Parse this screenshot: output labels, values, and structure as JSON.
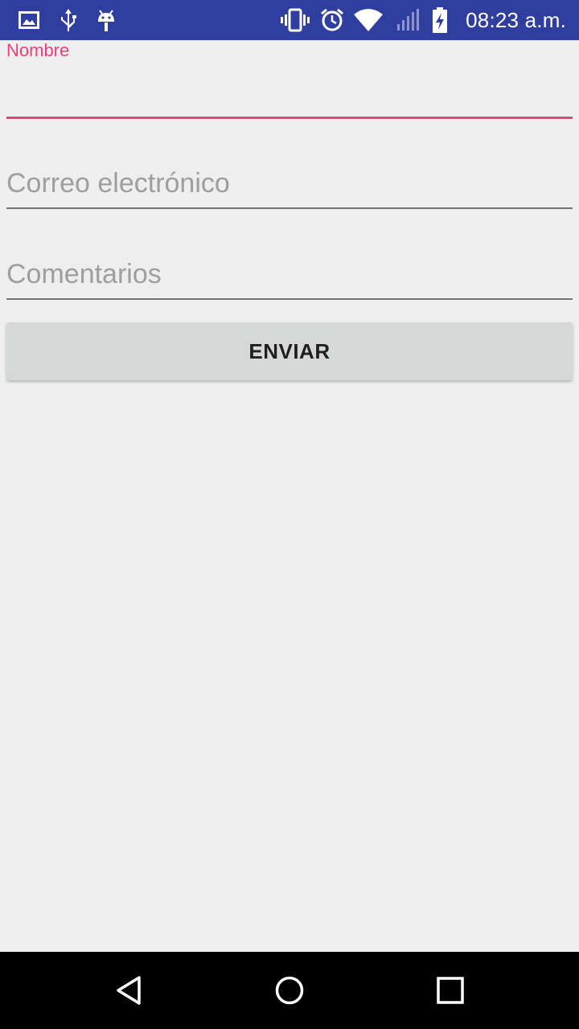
{
  "status_bar": {
    "time": "08:23 a.m.",
    "left_icons": [
      "image-icon",
      "usb-icon",
      "android-debug-icon"
    ],
    "right_icons": [
      "vibrate-icon",
      "alarm-icon",
      "wifi-icon",
      "signal-icon",
      "battery-charging-icon"
    ],
    "color": "#303f9f"
  },
  "form": {
    "nombre": {
      "label": "Nombre",
      "value": ""
    },
    "correo": {
      "placeholder": "Correo electrónico"
    },
    "comentarios": {
      "placeholder": "Comentarios"
    },
    "submit_label": "ENVIAR",
    "accent_color": "#ec407a"
  },
  "nav_bar": {
    "buttons": [
      "back-icon",
      "home-icon",
      "recents-icon"
    ]
  }
}
